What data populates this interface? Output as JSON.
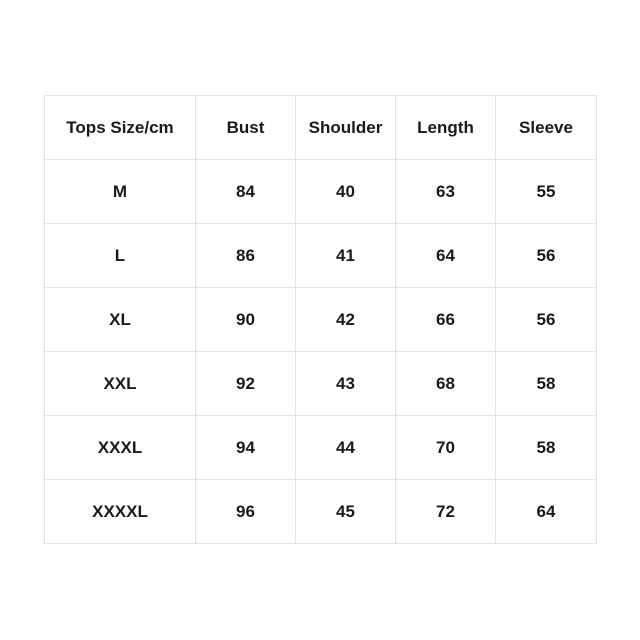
{
  "table": {
    "headers": [
      "Tops Size/cm",
      "Bust",
      "Shoulder",
      "Length",
      "Sleeve"
    ],
    "rows": [
      [
        "M",
        "84",
        "40",
        "63",
        "55"
      ],
      [
        "L",
        "86",
        "41",
        "64",
        "56"
      ],
      [
        "XL",
        "90",
        "42",
        "66",
        "56"
      ],
      [
        "XXL",
        "92",
        "43",
        "68",
        "58"
      ],
      [
        "XXXL",
        "94",
        "44",
        "70",
        "58"
      ],
      [
        "XXXXL",
        "96",
        "45",
        "72",
        "64"
      ]
    ]
  }
}
